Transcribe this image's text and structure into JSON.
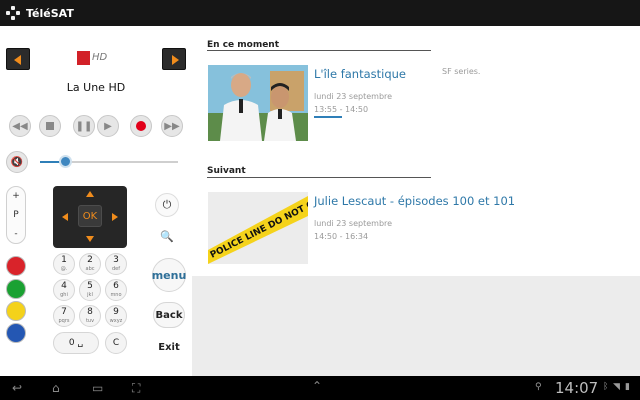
{
  "app": {
    "title": "TéléSAT"
  },
  "remote": {
    "channel_name": "La Une HD",
    "logo_text": "HD",
    "plus_minus": {
      "plus": "+",
      "label": "P",
      "minus": "-"
    },
    "ok_label": "OK",
    "volume_level": 0.18,
    "keypad": [
      {
        "num": "1",
        "letters": "@."
      },
      {
        "num": "2",
        "letters": "abc"
      },
      {
        "num": "3",
        "letters": "def"
      },
      {
        "num": "4",
        "letters": "ghi"
      },
      {
        "num": "5",
        "letters": "jkl"
      },
      {
        "num": "6",
        "letters": "mno"
      },
      {
        "num": "7",
        "letters": "pqrs"
      },
      {
        "num": "8",
        "letters": "tuv"
      },
      {
        "num": "9",
        "letters": "wxyz"
      }
    ],
    "zero_key": "0 ␣",
    "clear_key": "C",
    "menu_label": "menu",
    "back_label": "Back",
    "exit_label": "Exit",
    "color_buttons": [
      "#d9232a",
      "#1aa132",
      "#f4d21a",
      "#2457b3"
    ]
  },
  "now": {
    "section_label": "En ce moment",
    "title": "L'île fantastique",
    "genre": "SF series.",
    "date": "lundi 23 septembre",
    "time": "13:55 - 14:50",
    "progress": 0.5
  },
  "next": {
    "section_label": "Suivant",
    "title": "Julie Lescaut - épisodes 100 et 101",
    "date": "lundi 23 septembre",
    "time": "14:50 - 16:34",
    "tape_text": "POLICE LINE DO NOT CROSS"
  },
  "system": {
    "clock": "14:07"
  },
  "colors": {
    "accent_orange": "#f08c1c",
    "accent_blue": "#2e78a8",
    "record_red": "#e2001a"
  }
}
